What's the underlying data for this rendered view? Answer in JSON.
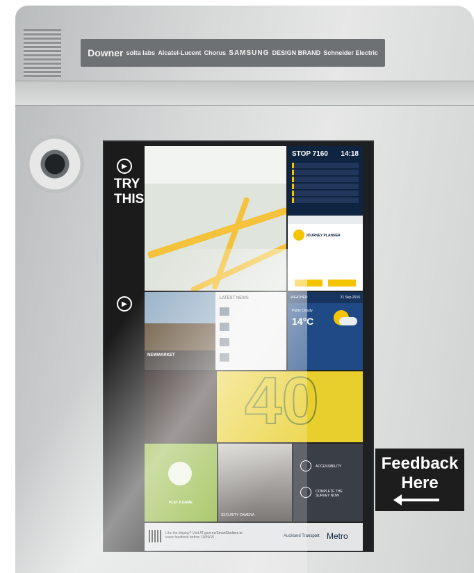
{
  "sponsors": [
    "Downer",
    "solta labs",
    "Alcatel-Lucent",
    "Chorus",
    "SAMSUNG",
    "DESIGN BRAND",
    "Schneider Electric"
  ],
  "screen": {
    "try_this": "TRY THIS",
    "stop": {
      "label": "STOP 7160",
      "time": "14:18"
    },
    "journey_planner": "JOURNEY PLANNER",
    "news_header": "LATEST NEWS",
    "news_caption": "NEWMARKET",
    "weather": {
      "label": "WEATHER",
      "date": "21 Sep 2015",
      "condition": "Partly Cloudy",
      "temp": "14°C"
    },
    "big_number": "40",
    "game_label": "PLAY A GAME",
    "camera_label": "SECURITY CAMERA",
    "accessibility_label": "ACCESSIBILITY",
    "survey_label": "COMPLETE THE SURVEY NOW",
    "footer_text": "Like the display? Visit AT.govt.nz/SmartShelters to leave feedback before 13/09/15",
    "footer_at": "Auckland Transport",
    "footer_metro": "Metro"
  },
  "feedback_sign": {
    "line1": "Feedback",
    "line2": "Here"
  }
}
